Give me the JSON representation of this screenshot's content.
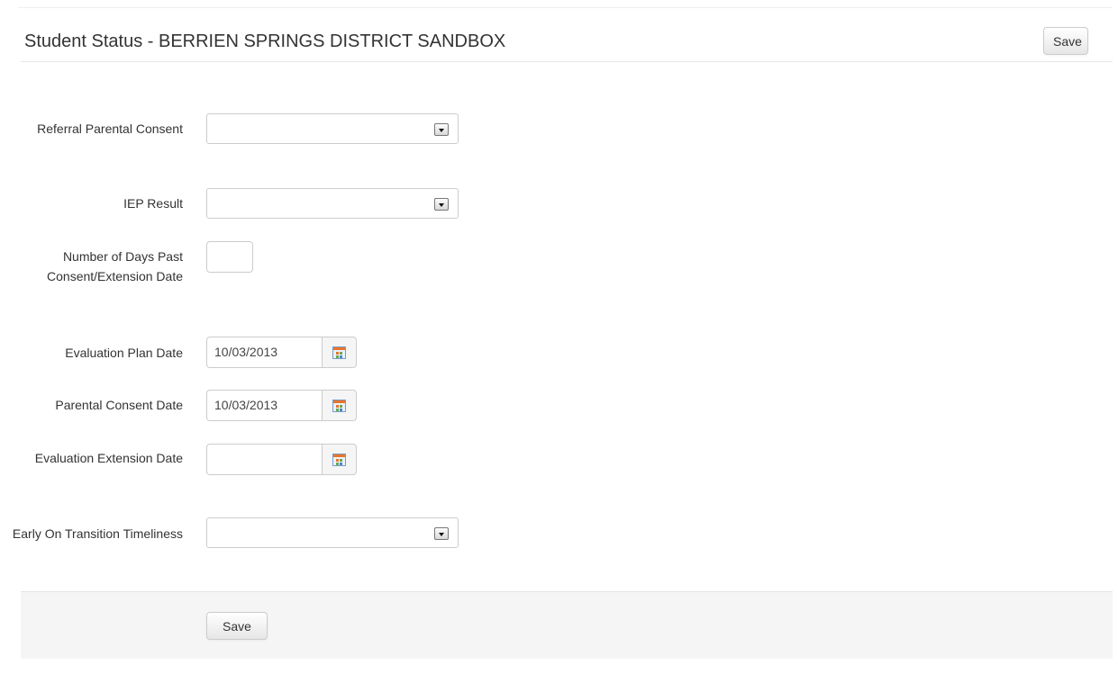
{
  "header": {
    "title": "Student Status - BERRIEN SPRINGS DISTRICT SANDBOX",
    "save_label": "Save"
  },
  "form": {
    "referral_parental_consent": {
      "label": "Referral Parental Consent",
      "value": ""
    },
    "iep_result": {
      "label": "IEP Result",
      "value": ""
    },
    "days_past_consent": {
      "label": "Number of Days Past Consent/Extension Date",
      "value": ""
    },
    "evaluation_plan_date": {
      "label": "Evaluation Plan Date",
      "value": "10/03/2013"
    },
    "parental_consent_date": {
      "label": "Parental Consent Date",
      "value": "10/03/2013"
    },
    "evaluation_extension_date": {
      "label": "Evaluation Extension Date",
      "value": ""
    },
    "early_on_transition_timeliness": {
      "label": "Early On Transition Timeliness",
      "value": ""
    }
  },
  "footer": {
    "save_label": "Save"
  },
  "icons": {
    "select": "dropdown-arrow-icon",
    "date": "calendar-icon"
  }
}
